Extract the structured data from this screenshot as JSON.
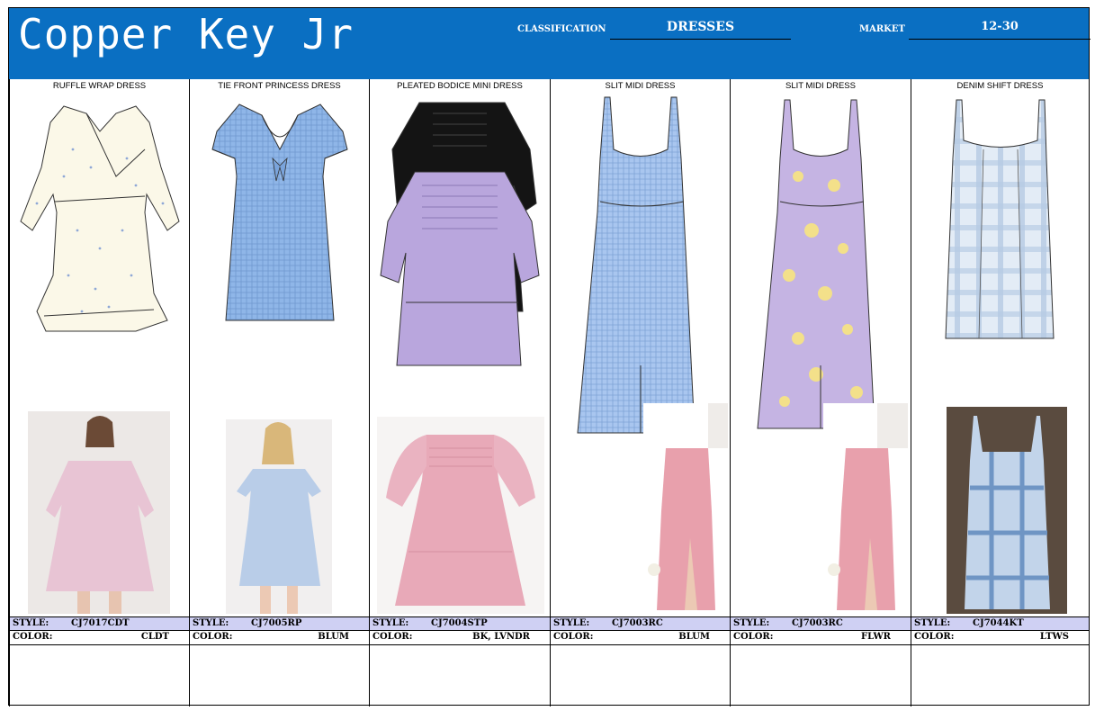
{
  "header": {
    "brand": "Copper Key Jr",
    "classification_label": "CLASSIFICATION",
    "classification_value": "DRESSES",
    "market_label": "MARKET",
    "market_value": "12-30"
  },
  "row_labels": {
    "style": "STYLE:",
    "color": "COLOR:"
  },
  "items": [
    {
      "name": "RUFFLE WRAP DRESS",
      "style": "CJ7017CDT",
      "color": "CLDT"
    },
    {
      "name": "TIE FRONT PRINCESS DRESS",
      "style": "CJ7005RP",
      "color": "BLUM"
    },
    {
      "name": "PLEATED BODICE MINI DRESS",
      "style": "CJ7004STP",
      "color": "BK, LVNDR"
    },
    {
      "name": "SLIT MIDI DRESS",
      "style": "CJ7003RC",
      "color": "BLUM"
    },
    {
      "name": "SLIT MIDI DRESS",
      "style": "CJ7003RC",
      "color": "FLWR"
    },
    {
      "name": "DENIM SHIFT DRESS",
      "style": "CJ7044KT",
      "color": "LTWS"
    }
  ],
  "colors": {
    "header_bg": "#0a6fc2",
    "style_row_bg": "#cfd0f3",
    "gingham_blue": "#8fb6e8",
    "lavender": "#b9a6dd",
    "pink": "#e8a9b8",
    "cream": "#fbf8e8",
    "plaid_blue": "#c5d6ea"
  }
}
